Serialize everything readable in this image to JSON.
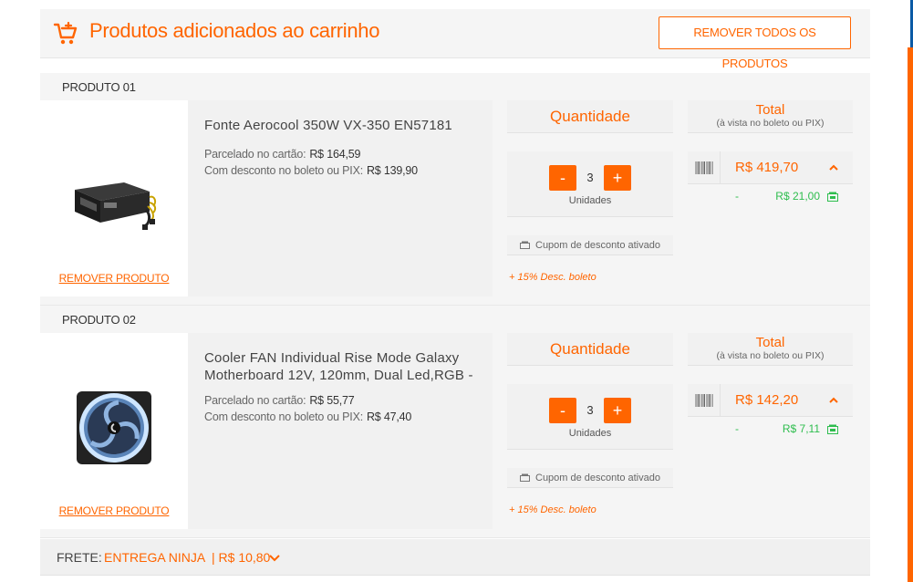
{
  "header": {
    "title": "Produtos adicionados ao carrinho",
    "remove_all_label": "REMOVER TODOS OS PRODUTOS"
  },
  "products": [
    {
      "label": "PRODUTO 01",
      "name": "Fonte Aerocool 350W VX-350 EN57181",
      "installment_label": "Parcelado no cartão:",
      "installment_price": "R$  164,59",
      "discount_label": "Com desconto no boleto ou PIX:",
      "discount_price": "R$  139,90",
      "remove_label": "REMOVER PRODUTO",
      "quantity_title": "Quantidade",
      "minus_label": "-",
      "quantity": "3",
      "plus_label": "+",
      "units_label": "Unidades",
      "coupon_label": "Cupom de desconto ativado",
      "discount_note": "+ 15% Desc. boleto",
      "total_title": "Total",
      "total_subtitle": "(à vista no boleto ou PIX)",
      "total_price": "R$  419,70",
      "saving_dash": "-",
      "saving_value": "R$  21,00",
      "image_icon": "power-supply-image"
    },
    {
      "label": "PRODUTO 02",
      "name": "Cooler FAN Individual Rise Mode Galaxy Motherboard 12V, 120mm, Dual Led,RGB -",
      "installment_label": "Parcelado no cartão:",
      "installment_price": "R$  55,77",
      "discount_label": "Com desconto no boleto ou PIX:",
      "discount_price": "R$  47,40",
      "remove_label": "REMOVER PRODUTO",
      "quantity_title": "Quantidade",
      "minus_label": "-",
      "quantity": "3",
      "plus_label": "+",
      "units_label": "Unidades",
      "coupon_label": "Cupom de desconto ativado",
      "discount_note": "+ 15% Desc. boleto",
      "total_title": "Total",
      "total_subtitle": "(à vista no boleto ou PIX)",
      "total_price": "R$  142,20",
      "saving_dash": "-",
      "saving_value": "R$  7,11",
      "image_icon": "cooler-fan-image"
    }
  ],
  "frete": {
    "label": "FRETE:",
    "method": "ENTREGA NINJA",
    "separator_price": "| R$  10,80"
  },
  "colors": {
    "accent": "#ff6500",
    "success": "#2ebd4e",
    "panel": "#f5f5f5",
    "edge_blue": "#0a5aa5"
  }
}
